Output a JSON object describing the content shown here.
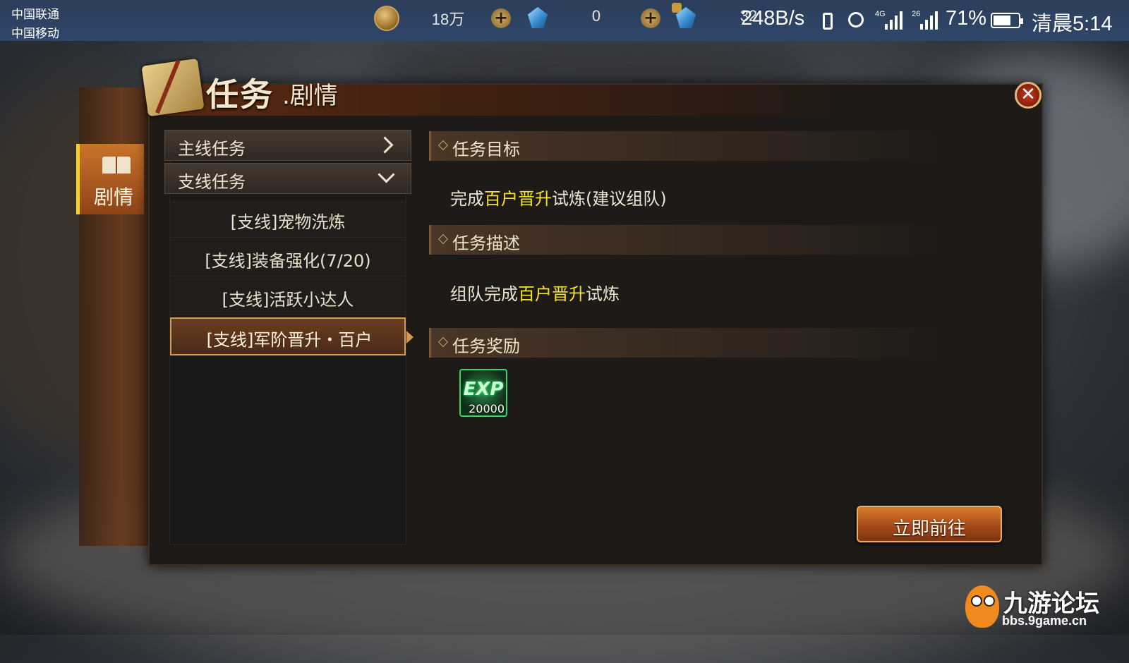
{
  "status_bar": {
    "carrier_1": "中国联通",
    "carrier_2": "中国移动",
    "net_speed": "248B/s",
    "signal_1_tag": "4G",
    "signal_2_tag": "26",
    "battery": "71%",
    "battery_level": 0.71,
    "time": "清晨5:14"
  },
  "resources": {
    "gold": "18万",
    "gem": "0",
    "bound_gem": "32"
  },
  "icons": [
    "coin-icon",
    "gem-icon",
    "plus-icon",
    "lock-icon",
    "vibrate-icon",
    "alarm-icon",
    "signal-icon",
    "battery-icon",
    "book-icon",
    "close-icon",
    "chevron-right-icon",
    "chevron-down-icon",
    "exp-icon"
  ],
  "side_tab": {
    "label": "剧情"
  },
  "dialog": {
    "title_main": "任务",
    "title_sub": ".剧情",
    "close": "✕"
  },
  "quest_list": {
    "main_category": "主线任务",
    "side_category": "支线任务",
    "items": [
      {
        "label": "[支线]宠物洗炼"
      },
      {
        "label": "[支线]装备强化(7/20)"
      },
      {
        "label": "[支线]活跃小达人"
      },
      {
        "label": "[支线]军阶晋升・百户",
        "selected": true
      }
    ]
  },
  "detail": {
    "objective_header": "任务目标",
    "objective": {
      "pre": "完成",
      "highlight": "百户晋升",
      "post": "试炼(建议组队)"
    },
    "description_header": "任务描述",
    "description": {
      "pre": "组队完成",
      "highlight": "百户晋升",
      "post": "试炼"
    },
    "reward_header": "任务奖励",
    "reward": {
      "label": "EXP",
      "amount": "20000"
    },
    "go_button": "立即前往"
  },
  "colors": {
    "highlight": "#f5e22a",
    "accent_orange": "#c9742b",
    "tab_marker": "#f5d22e",
    "exp_border": "#3ed06a"
  },
  "watermark": {
    "title": "九游论坛",
    "url": "bbs.9game.cn"
  }
}
